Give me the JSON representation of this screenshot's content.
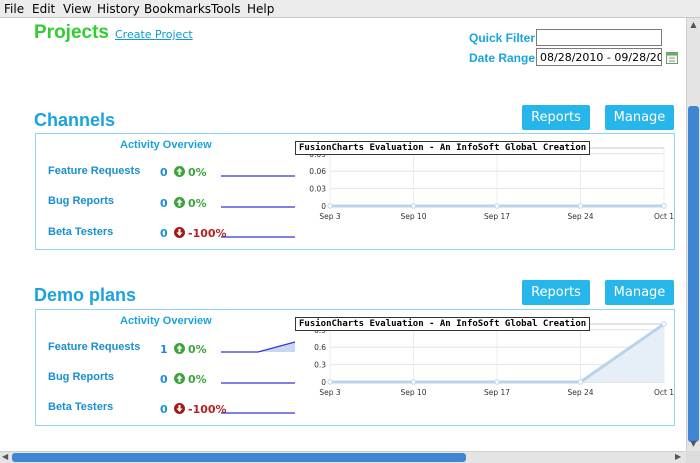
{
  "menu": [
    "File",
    "Edit",
    "View",
    "History",
    "Bookmarks",
    "Tools",
    "Help"
  ],
  "header": {
    "title": "Projects",
    "create_link": "Create Project",
    "quick_filter_label": "Quick Filter:",
    "quick_filter_value": "",
    "date_range_label": "Date Range:",
    "date_range_value": "08/28/2010 - 09/28/20"
  },
  "sections": [
    {
      "title": "Channels",
      "reports_label": "Reports",
      "manage_label": "Manage",
      "overview_title": "Activity Overview",
      "rows": [
        {
          "label": "Feature Requests",
          "count": "0",
          "direction": "up",
          "pct": "0%"
        },
        {
          "label": "Bug Reports",
          "count": "0",
          "direction": "up",
          "pct": "0%"
        },
        {
          "label": "Beta Testers",
          "count": "0",
          "direction": "down",
          "pct": "-100%"
        }
      ],
      "chart_banner": "FusionCharts Evaluation - An InfoSoft Global Creation"
    },
    {
      "title": "Demo plans",
      "reports_label": "Reports",
      "manage_label": "Manage",
      "overview_title": "Activity Overview",
      "rows": [
        {
          "label": "Feature Requests",
          "count": "1",
          "direction": "up",
          "pct": "0%"
        },
        {
          "label": "Bug Reports",
          "count": "0",
          "direction": "up",
          "pct": "0%"
        },
        {
          "label": "Beta Testers",
          "count": "0",
          "direction": "down",
          "pct": "-100%"
        }
      ],
      "chart_banner": "FusionCharts Evaluation - An InfoSoft Global Creation"
    }
  ],
  "colors": {
    "accent": "#1aa3dd",
    "button": "#27b6ea",
    "project_title": "#33cc33",
    "up": "#3ba53b",
    "down": "#b81f1f",
    "line": "#b8d4ec"
  },
  "chart_data": [
    {
      "type": "area",
      "categories": [
        "Sep 3",
        "Sep 10",
        "Sep 17",
        "Sep 24",
        "Oct 1"
      ],
      "yticks": [
        "0.09",
        "0.06",
        "0.03",
        "0"
      ],
      "ylim": [
        0,
        0.1
      ],
      "values": [
        0,
        0,
        0,
        0,
        0
      ],
      "grid": true
    },
    {
      "type": "area",
      "categories": [
        "Sep 3",
        "Sep 10",
        "Sep 17",
        "Sep 24",
        "Oct 1"
      ],
      "yticks": [
        "0.9",
        "0.6",
        "0.3",
        "0"
      ],
      "ylim": [
        0,
        1
      ],
      "values": [
        0,
        0,
        0,
        0,
        1
      ],
      "grid": true
    }
  ],
  "sparklines": [
    [
      [
        0,
        0
      ],
      [
        0,
        0
      ],
      [
        0,
        0
      ]
    ],
    [
      [
        0,
        0,
        1
      ],
      [
        0,
        0,
        0
      ],
      [
        0,
        0,
        0
      ]
    ]
  ]
}
